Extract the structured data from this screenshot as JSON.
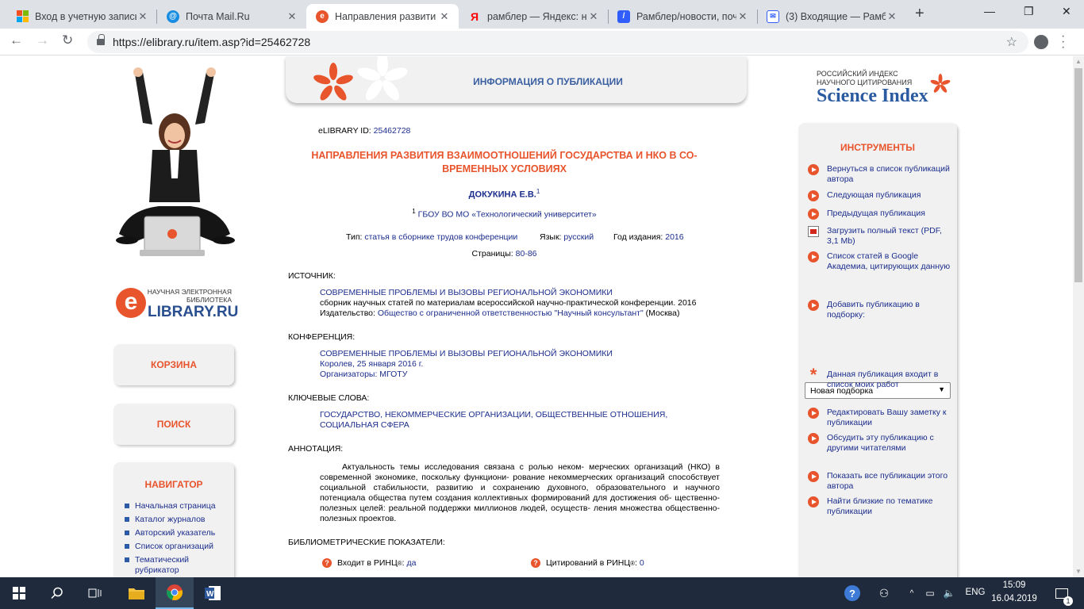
{
  "browser": {
    "tabs": [
      {
        "title": "Вход в учетную запись",
        "favicon": "windows-icon",
        "color": "#f25022"
      },
      {
        "title": "Почта Mail.Ru",
        "favicon": "mailru-icon",
        "color": "#168de2"
      },
      {
        "title": "Направления развити",
        "favicon": "elibrary-icon",
        "color": "#e8542c",
        "active": true
      },
      {
        "title": "рамблер — Яндекс: на",
        "favicon": "yandex-icon",
        "color": "#ff0000"
      },
      {
        "title": "Рамблер/новости, поч",
        "favicon": "rambler-news-icon",
        "color": "#315efb"
      },
      {
        "title": "(3) Входящие — Рамбл",
        "favicon": "rambler-mail-icon",
        "color": "#315efb"
      }
    ],
    "url": "https://elibrary.ru/item.asp?id=25462728"
  },
  "left": {
    "logo_small": "НАУЧНАЯ ЭЛЕКТРОННАЯ БИБЛИОТЕКА",
    "logo_big": "LIBRARY.RU",
    "logo_e": "e",
    "cart": "КОРЗИНА",
    "search": "ПОИСК",
    "nav_title": "НАВИГАТОР",
    "nav_items": [
      "Начальная страница",
      "Каталог журналов",
      "Авторский указатель",
      "Список организаций",
      "Тематический рубрикатор"
    ]
  },
  "header": {
    "title": "ИНФОРМАЦИЯ О ПУБЛИКАЦИИ"
  },
  "pub": {
    "elibrary_id_label": "eLIBRARY ID:",
    "elibrary_id": "25462728",
    "title": "НАПРАВЛЕНИЯ РАЗВИТИЯ ВЗАИМООТНОШЕНИЙ ГОСУДАРСТВА И НКО В СО-ВРЕМЕННЫХ УСЛОВИЯХ",
    "author": "ДОКУКИНА Е.В.",
    "author_sup": "1",
    "affil_sup": "1",
    "affiliation": "ГБОУ ВО МО «Технологический университет»",
    "type_label": "Тип:",
    "type": "статья в сборнике трудов конференции",
    "lang_label": "Язык:",
    "lang": "русский",
    "year_label": "Год издания:",
    "year": "2016",
    "pages_label": "Страницы:",
    "pages": "80-86",
    "source_label": "ИСТОЧНИК:",
    "source_name": "СОВРЕМЕННЫЕ ПРОБЛЕМЫ И ВЫЗОВЫ РЕГИОНАЛЬНОЙ ЭКОНОМИКИ",
    "source_desc": "сборник научных статей по материалам всероссийской научно-практической конференции. 2016",
    "publisher_label": "Издательство:",
    "publisher": "Общество с ограниченной ответственностью \"Научный консультант\"",
    "publisher_city": "(Москва)",
    "conf_label": "КОНФЕРЕНЦИЯ:",
    "conf_name": "СОВРЕМЕННЫЕ ПРОБЛЕМЫ И ВЫЗОВЫ РЕГИОНАЛЬНОЙ ЭКОНОМИКИ",
    "conf_place": "Королев, 25 января 2016 г.",
    "org_label": "Организаторы:",
    "org": "МГОТУ",
    "kw_label": "КЛЮЧЕВЫЕ СЛОВА:",
    "keywords": "ГОСУДАРСТВО, НЕКОММЕРЧЕСКИЕ ОРГАНИЗАЦИИ, ОБЩЕСТВЕННЫЕ ОТНОШЕНИЯ, СОЦИАЛЬНАЯ СФЕРА",
    "abs_label": "АННОТАЦИЯ:",
    "abstract": "Актуальность темы исследования связана с ролью неком- мерческих организаций (НКО) в современной экономике, поскольку функциони- рование некоммерческих организаций способствует социальной стабильности, развитию и сохранению духовного, образовательного и научного потенциала общества путем создания коллективных формирований для достижения об- щественно-полезных целей: реальной поддержки миллионов людей, осуществ- ления множества общественно-полезных проектов.",
    "bib_label": "БИБЛИОМЕТРИЧЕСКИЕ ПОКАЗАТЕЛИ:",
    "rinc_in_label": "Входит в РИНЦ",
    "rinc_in_value": "да",
    "rinc_cit_label": "Цитирований в РИНЦ",
    "rinc_cit_value": "0",
    "reg": "®"
  },
  "right": {
    "si_small": "РОССИЙСКИЙ ИНДЕКС НАУЧНОГО ЦИТИРОВАНИЯ",
    "si_big": "Science Index",
    "tools_title": "ИНСТРУМЕНТЫ",
    "tools": [
      "Вернуться в список публикаций автора",
      "Следующая публикация",
      "Предыдущая публикация",
      "Загрузить полный текст (PDF, 3,1 Mb)",
      "Список статей в Google Академиа, цитирующих данную",
      "Добавить публикацию в подборку:",
      "Данная публикация входит в список моих работ",
      "Редактировать Вашу заметку к публикации",
      "Обсудить эту публикацию с другими читателями",
      "Показать все публикации этого автора",
      "Найти близкие по тематике публикации"
    ],
    "collection_select": "Новая подборка"
  },
  "taskbar": {
    "lang": "ENG",
    "time": "15:09",
    "date": "16.04.2019",
    "notif_count": "1"
  }
}
